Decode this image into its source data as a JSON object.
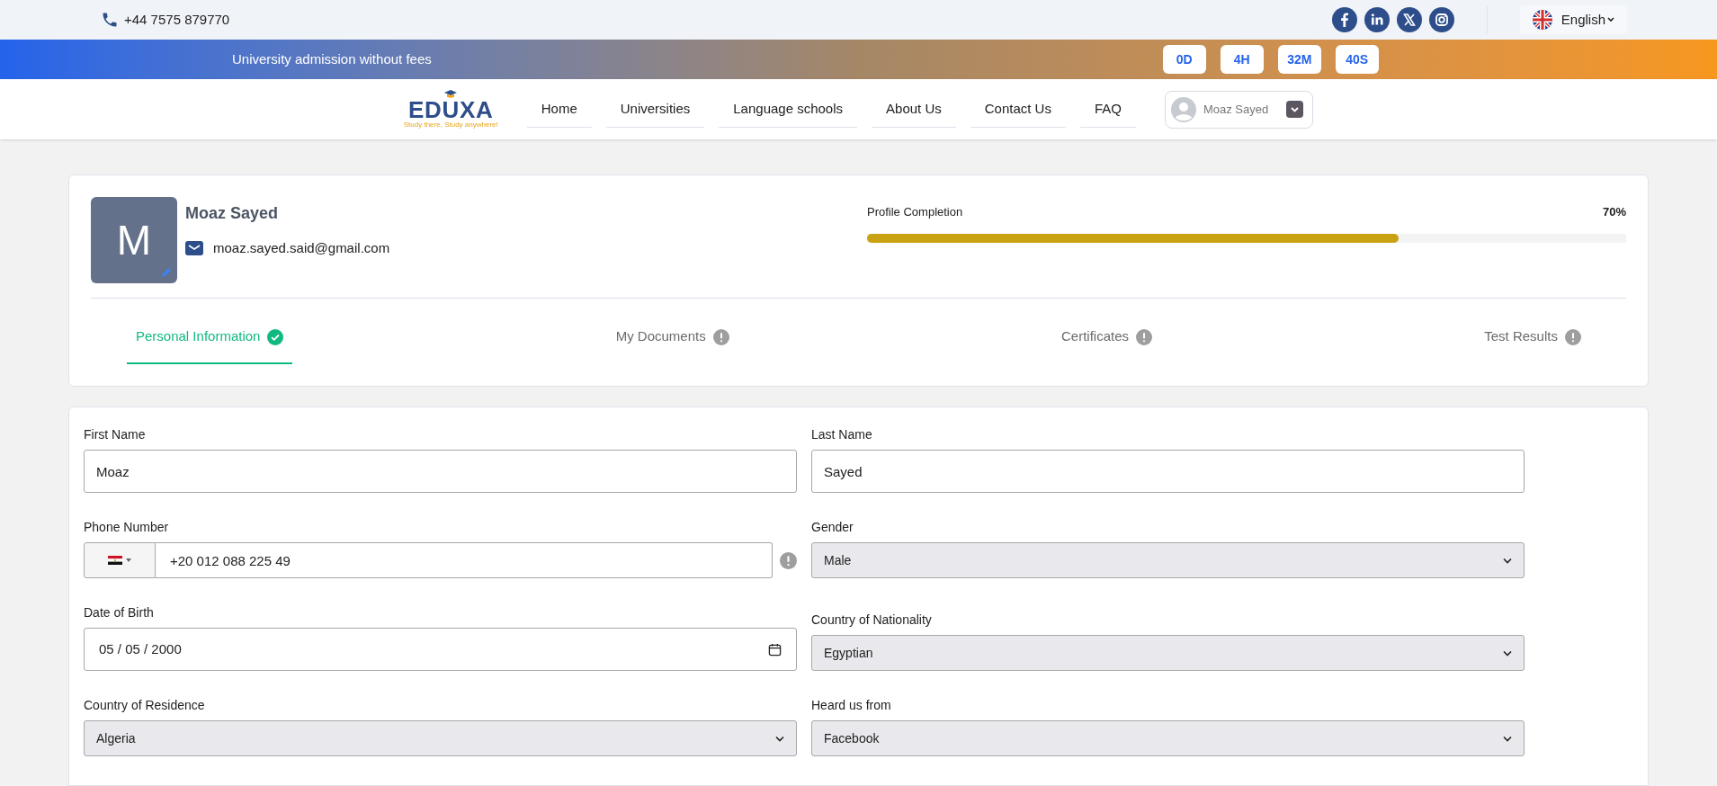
{
  "top_bar": {
    "phone": "+44 7575 879770",
    "language": "English"
  },
  "promo_bar": {
    "text": "University admission without fees",
    "countdown": [
      "0D",
      "4H",
      "32M",
      "40S"
    ]
  },
  "navbar": {
    "logo": {
      "name": "EDUXA",
      "tagline": "Study there, Study anywhere!"
    },
    "links": [
      "Home",
      "Universities",
      "Language schools",
      "About Us",
      "Contact Us",
      "FAQ"
    ],
    "user": {
      "name": "Moaz Sayed"
    }
  },
  "profile": {
    "initial": "M",
    "name": "Moaz Sayed",
    "email": "moaz.sayed.said@gmail.com",
    "completion": {
      "label": "Profile Completion",
      "reading": "70%",
      "level": 0.7
    },
    "tabs": [
      {
        "label": "Personal Information",
        "selected": true,
        "complete": true
      },
      {
        "label": "My Documents",
        "selected": false,
        "complete": false
      },
      {
        "label": "Certificates",
        "selected": false,
        "complete": false
      },
      {
        "label": "Test Results",
        "selected": false,
        "complete": false
      }
    ]
  },
  "form": {
    "fields": [
      {
        "kind": "text",
        "label": "First Name",
        "value": "Moaz"
      },
      {
        "kind": "text",
        "label": "Last Name",
        "value": "Sayed"
      },
      {
        "kind": "phone",
        "label": "Phone Number",
        "value": "+20 012 088 225 49"
      },
      {
        "kind": "select",
        "label": "Gender",
        "value": "Male"
      },
      {
        "kind": "date",
        "label": "Date of Birth",
        "value": "05 / 05 / 2000"
      },
      {
        "kind": "select",
        "label": "Country of Nationality",
        "value": "Egyptian"
      },
      {
        "kind": "select",
        "label": "Country of Residence",
        "value": "Algeria"
      },
      {
        "kind": "select",
        "label": "Heard us from",
        "value": "Facebook"
      }
    ]
  }
}
